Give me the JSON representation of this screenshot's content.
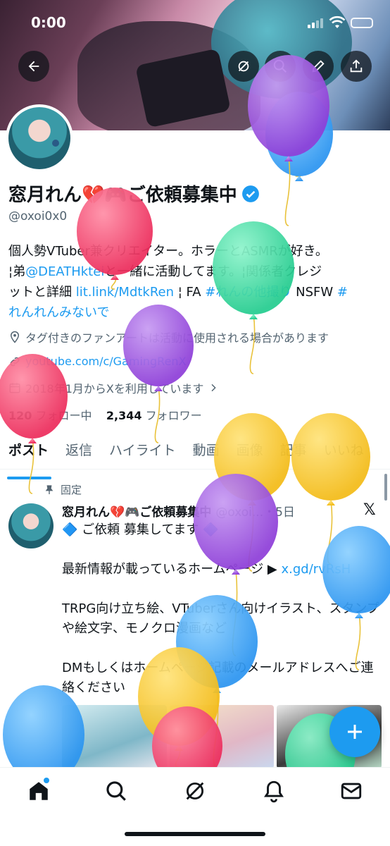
{
  "status_bar": {
    "time": "0:00"
  },
  "profile": {
    "display_name": "窓月れん💔🎮ご依頼募集中",
    "handle": "@oxoi0x0",
    "bio_lines": [
      [
        "個人勢VTuber兼クリエイター。",
        "ホラーとASMRが好き。"
      ],
      [
        "¦弟",
        "@DEATHktei",
        "と一緒に活動してます。¦関係者クレジ"
      ],
      [
        "ットと詳細 ",
        "lit.link/MdtkRen",
        " ¦ FA ",
        "#れんの他撮り",
        " NSFW ",
        "#"
      ],
      [
        "れんれんみないで"
      ]
    ],
    "location_note": "タグ付きのファンアートは活動に使用される場合があります",
    "website": "youtube.com/c/GamingRenX",
    "joined": "2018年1月からXを利用しています",
    "following_count": "120",
    "following_label": "フォロー中",
    "followers_count": "2,344",
    "followers_label": "フォロワー"
  },
  "tabs": [
    "ポスト",
    "返信",
    "ハイライト",
    "動画",
    "画像",
    "記事",
    "いいね"
  ],
  "pinned_post": {
    "pinned_label": "固定",
    "author": "窓月れん💔🎮ご依頼募集中",
    "meta": "@oxoi...・5日",
    "line1": "🔷 ご依頼 募集してます 🔷",
    "line2_text": "最新情報が載っているホームページ ▶ ",
    "line2_link": "x.gd/rvRsH",
    "line3": "TRPG向け立ち絵、VTuberさん向けイラスト、スタンプや絵文字、モノクロ漫画など",
    "line4": "DMもしくはホームページ記載のメールアドレスへご連絡ください"
  },
  "icons": [
    "back-arrow-icon",
    "grok-icon",
    "search-icon",
    "edit-icon",
    "share-icon",
    "location-icon",
    "link-icon",
    "calendar-icon",
    "pin-icon",
    "x-logo-icon",
    "compose-icon",
    "home-icon",
    "explore-icon",
    "grok-nav-icon",
    "notifications-icon",
    "messages-icon"
  ],
  "colors": {
    "accent": "#1d9bf0",
    "text": "#0f1419",
    "secondary": "#536471"
  }
}
